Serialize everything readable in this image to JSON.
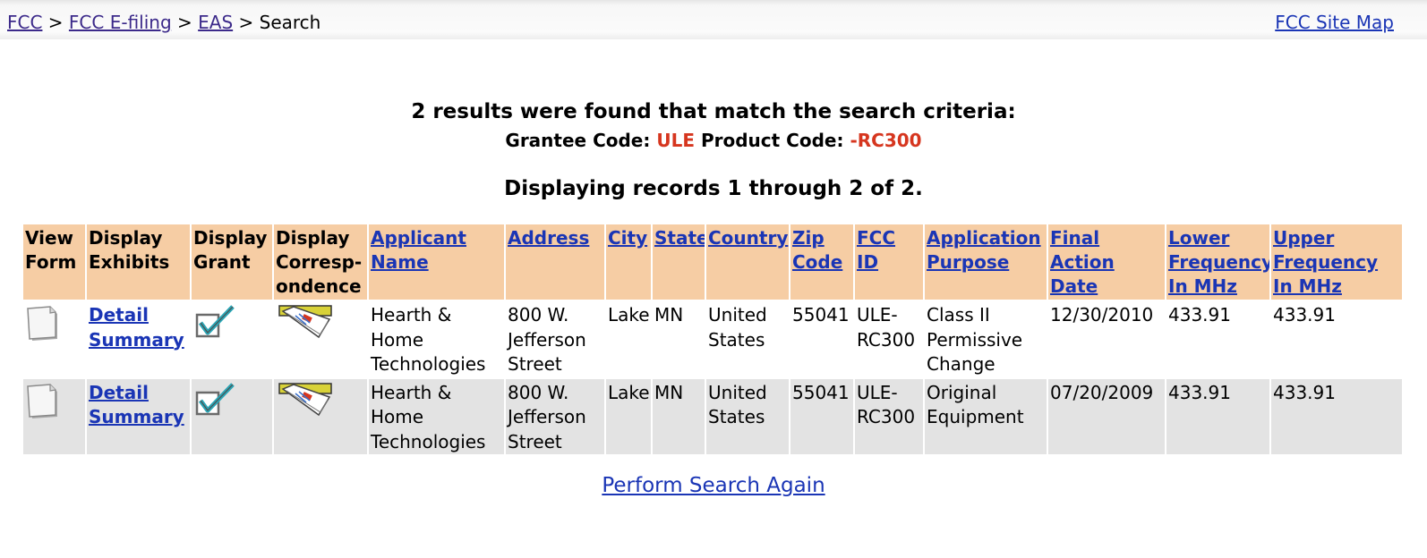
{
  "breadcrumb": {
    "fcc": "FCC",
    "efiling": "FCC E-filing",
    "eas": "EAS",
    "current": "Search",
    "sep": ">"
  },
  "site_map": "FCC Site Map",
  "summary": {
    "count_text": "2 results were found that match the search criteria:",
    "grantee_label": "Grantee Code:",
    "grantee_value": "ULE",
    "product_label": "Product Code:",
    "product_value": "-RC300",
    "display_text": "Displaying records 1 through 2 of 2."
  },
  "columns": [
    "View Form",
    "Display Exhibits",
    "Display Grant",
    "Display Corresp-ondence",
    "Applicant Name",
    "Address",
    "City",
    "State",
    "Country",
    "Zip Code",
    "FCC ID",
    "Application Purpose",
    "Final Action Date",
    "Lower Frequency In MHz",
    "Upper Frequency In MHz"
  ],
  "rows": [
    {
      "exhibits": "Detail Summary",
      "applicant": "Hearth & Home Technologies",
      "address": "800 W. Jefferson Street",
      "city": "Lake",
      "state": "MN",
      "country": "United States",
      "zip": "55041",
      "fcc_id": "ULE-RC300",
      "purpose": "Class II Permissive Change",
      "date": "12/30/2010",
      "lower": "433.91",
      "upper": "433.91"
    },
    {
      "exhibits": "Detail Summary",
      "applicant": "Hearth & Home Technologies",
      "address": "800 W. Jefferson Street",
      "city": "Lake",
      "state": "MN",
      "country": "United States",
      "zip": "55041",
      "fcc_id": "ULE-RC300",
      "purpose": "Original Equipment",
      "date": "07/20/2009",
      "lower": "433.91",
      "upper": "433.91"
    }
  ],
  "icons": {
    "view_form": "document-icon",
    "grant": "checkmark-icon",
    "correspondence": "envelope-icon"
  },
  "colors": {
    "header_bg": "#f6cda4",
    "alt_row_bg": "#e3e3e3",
    "highlight_red": "#d6361f",
    "link_blue": "#1a35b5"
  },
  "search_again": "Perform Search Again"
}
